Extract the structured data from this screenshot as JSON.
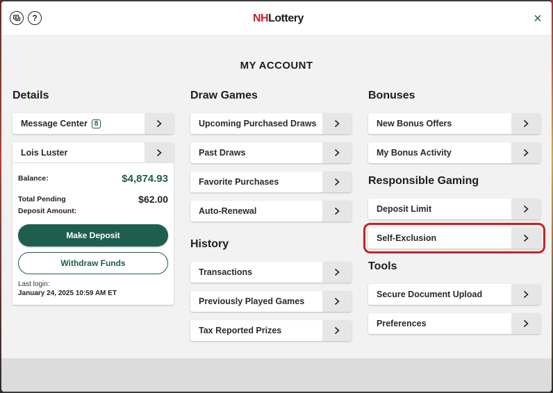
{
  "header": {
    "logo_nh": "NH",
    "logo_lottery": "Lottery",
    "help_glyph": "?",
    "close_glyph": "×",
    "page_title": "MY ACCOUNT"
  },
  "details": {
    "title": "Details",
    "message_center": {
      "label": "Message Center",
      "badge": "8"
    },
    "user_name": "Lois Luster",
    "balance_label": "Balance:",
    "balance_value": "$4,874.93",
    "pending_label_1": "Total Pending",
    "pending_label_2": "Deposit Amount:",
    "pending_value": "$62.00",
    "make_deposit": "Make Deposit",
    "withdraw_funds": "Withdraw Funds",
    "last_login_label": "Last login:",
    "last_login_value": "January 24, 2025 10:59 AM ET"
  },
  "draw_games": {
    "title": "Draw Games",
    "items": [
      {
        "label": "Upcoming Purchased Draws"
      },
      {
        "label": "Past Draws"
      },
      {
        "label": "Favorite Purchases"
      },
      {
        "label": "Auto-Renewal"
      }
    ]
  },
  "history": {
    "title": "History",
    "items": [
      {
        "label": "Transactions"
      },
      {
        "label": "Previously Played Games"
      },
      {
        "label": "Tax Reported Prizes"
      }
    ]
  },
  "bonuses": {
    "title": "Bonuses",
    "items": [
      {
        "label": "New Bonus Offers"
      },
      {
        "label": "My Bonus Activity"
      }
    ]
  },
  "responsible_gaming": {
    "title": "Responsible Gaming",
    "items": [
      {
        "label": "Deposit Limit"
      },
      {
        "label": "Self-Exclusion"
      }
    ]
  },
  "tools": {
    "title": "Tools",
    "items": [
      {
        "label": "Secure Document Upload"
      },
      {
        "label": "Preferences"
      }
    ]
  },
  "colors": {
    "accent": "#1e5e4f",
    "brand_red": "#c8202c",
    "highlight": "#d11f1f"
  },
  "icons": {
    "chat": "chat-icon",
    "help": "help-icon",
    "close": "close-icon",
    "chevron": "chevron-right-icon"
  }
}
